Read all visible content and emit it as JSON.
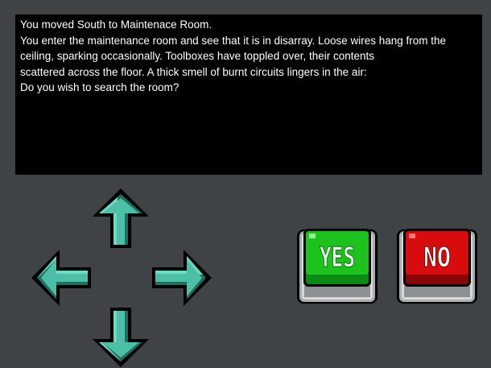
{
  "message": {
    "lines": [
      "You moved South to Maintenace Room.",
      "You enter the maintenance room and see that it is in disarray. Loose wires hang from the",
      "ceiling, sparking occasionally. Toolboxes have toppled over, their contents",
      "scattered across the floor. A thick smell of burnt circuits lingers in the air:",
      "Do you wish to search the room?"
    ]
  },
  "controls": {
    "dpad": {
      "up_icon": "arrow-up-icon",
      "down_icon": "arrow-down-icon",
      "left_icon": "arrow-left-icon",
      "right_icon": "arrow-right-icon",
      "color": "#4dbfa6"
    },
    "yes": {
      "label": "YES",
      "color": "#1ec21e"
    },
    "no": {
      "label": "NO",
      "color": "#d80c0c"
    }
  }
}
